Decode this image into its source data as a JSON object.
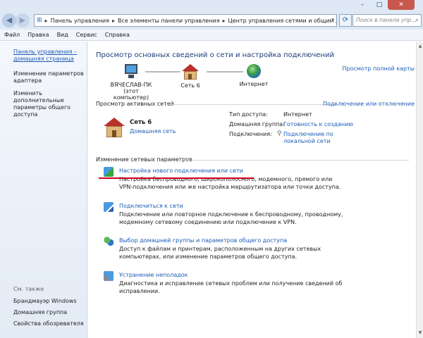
{
  "window": {
    "controls": {
      "minimize": "–",
      "maximize": "□",
      "close": "✕"
    }
  },
  "address": {
    "crumbs": [
      "Панель управления",
      "Все элементы панели управления",
      "Центр управления сетями и общим доступом"
    ],
    "search_placeholder": "Поиск в панели упр..."
  },
  "menu": [
    "Файл",
    "Правка",
    "Вид",
    "Сервис",
    "Справка"
  ],
  "left_pane": {
    "home_link": "Панель управления – домашняя страница",
    "links": [
      "Изменение параметров адаптера",
      "Изменить дополнительные параметры общего доступа"
    ],
    "see_also_label": "См. также",
    "see_also": [
      "Брандмауэр Windows",
      "Домашняя группа",
      "Свойства обозревателя"
    ]
  },
  "main": {
    "title": "Просмотр основных сведений о сети и настройка подключений",
    "full_map_link": "Просмотр полной карты",
    "map": {
      "computer_name": "ВЯЧЕСЛАВ-ПК",
      "computer_sub": "(этот компьютер)",
      "network_name": "Сеть 6",
      "internet_label": "Интернет"
    },
    "active_label": "Просмотр активных сетей",
    "connect_link": "Подключение или отключение",
    "active_network": {
      "name": "Сеть 6",
      "type_link": "Домашняя сеть"
    },
    "info": {
      "access_key": "Тип доступа:",
      "access_val": "Интернет",
      "group_key": "Домашняя группа:",
      "group_val": "Готовность к созданию",
      "conn_key": "Подключения:",
      "conn_val": "Подключение по локальной сети"
    },
    "change_label": "Изменение сетевых параметров",
    "tasks": [
      {
        "title": "Настройка нового подключения или сети",
        "desc": "Настройка беспроводного, широкополосного, модемного, прямого или VPN-подключения или же настройка маршрутизатора или точки доступа."
      },
      {
        "title": "Подключиться к сети",
        "desc": "Подключение или повторное подключение к беспроводному, проводному, модемному сетевому соединению или подключение к VPN."
      },
      {
        "title": "Выбор домашней группы и параметров общего доступа",
        "desc": "Доступ к файлам и принтерам, расположенным на других сетевых компьютерах, или изменение параметров общего доступа."
      },
      {
        "title": "Устранение неполадок",
        "desc": "Диагностика и исправление сетевых проблем или получение сведений об исправлении."
      }
    ]
  },
  "icons": {
    "address": "network-center-icon",
    "refresh": "refresh-icon",
    "search": "search-icon"
  },
  "colors": {
    "link": "#1a5bb5",
    "title": "#1e3d7a",
    "highlight": "#d0021b"
  }
}
